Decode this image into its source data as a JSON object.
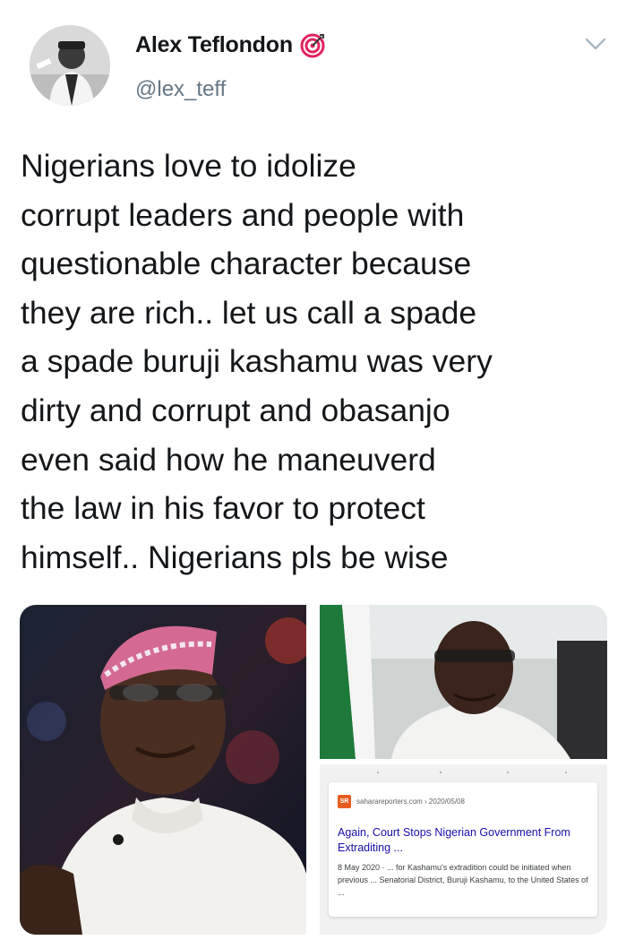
{
  "user": {
    "display_name": "Alex Teflondon",
    "handle": "@lex_teff",
    "badge_icon": "target-icon",
    "accent_color": "#e0245e"
  },
  "tweet": {
    "lines": [
      "Nigerians love to idolize",
      "corrupt leaders and people with",
      "questionable character because",
      "they are rich.. let us call a spade",
      "a spade buruji kashamu was very",
      "dirty and corrupt and obasanjo",
      "even said how he maneuverd",
      "the law in his favor to protect",
      "himself.. Nigerians pls be wise"
    ]
  },
  "media": {
    "search_result": {
      "logo_text": "SR",
      "site": "saharareporters.com › 2020/05/08",
      "title": "Again, Court Stops Nigerian Government From Extraditing ...",
      "snippet": "8 May 2020 · ... for Kashamu's extradition could be initiated when previous ... Senatorial District, Buruji Kashamu, to the United States of ..."
    }
  },
  "colors": {
    "text_primary": "#14171a",
    "text_secondary": "#657786",
    "link_blue": "#1a0dab"
  }
}
